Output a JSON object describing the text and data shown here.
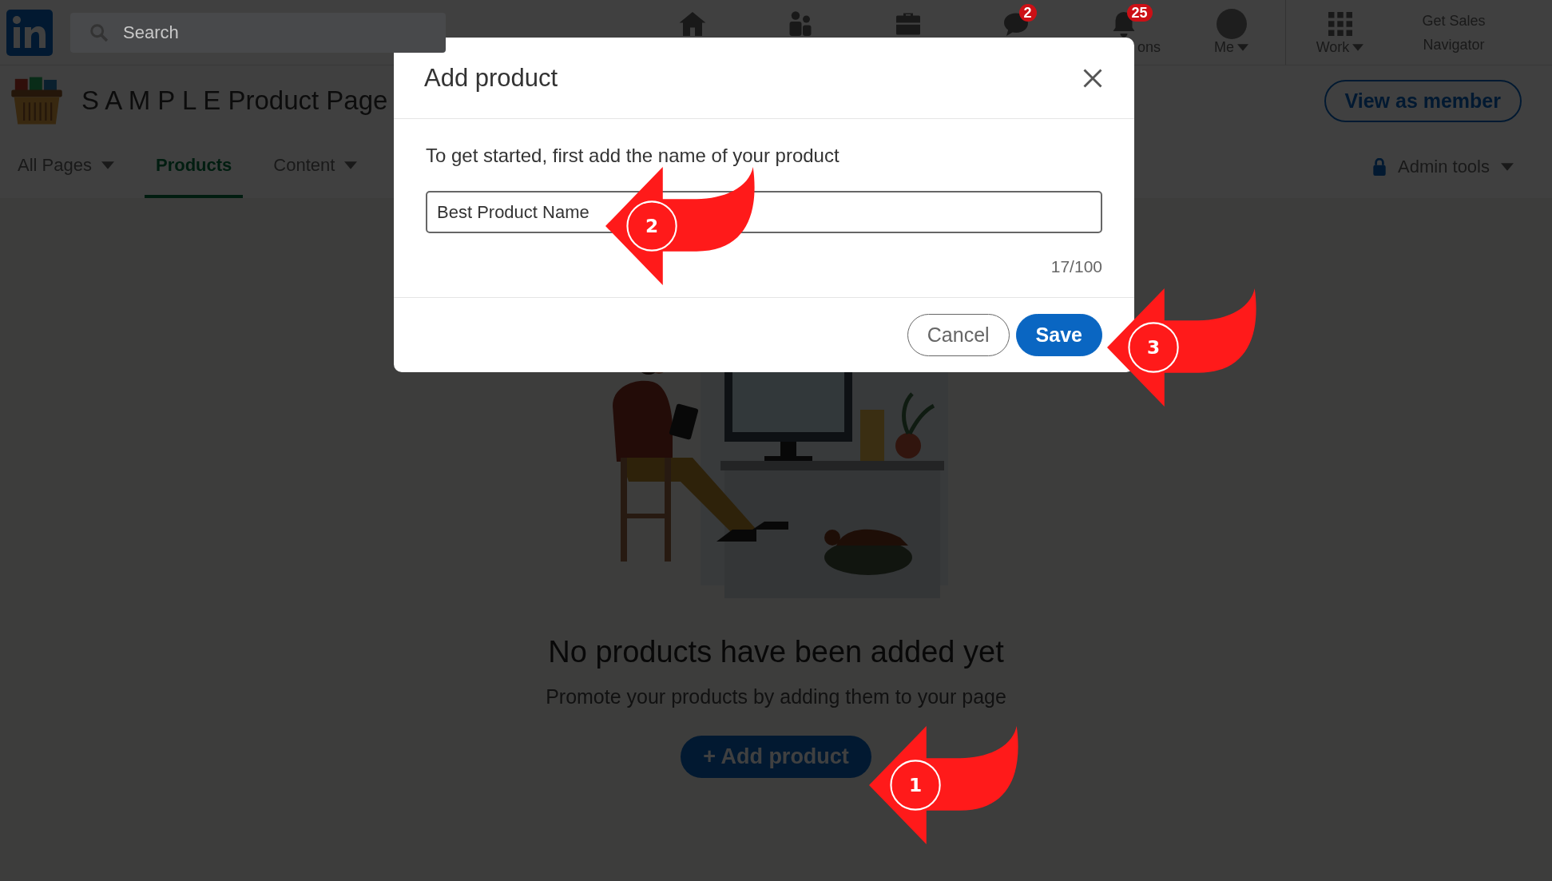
{
  "nav": {
    "search": {
      "placeholder": "Search"
    },
    "items": [
      {
        "kind": "home"
      },
      {
        "kind": "people"
      },
      {
        "kind": "briefcase"
      },
      {
        "kind": "chat",
        "badge": "2"
      },
      {
        "kind": "bell",
        "label": "ons",
        "badge": "25"
      },
      {
        "kind": "avatar",
        "label": "Me",
        "dropdown": true
      },
      {
        "kind": "grid",
        "label": "Work",
        "dropdown": true
      },
      {
        "kind": "text",
        "label": "Get Sales Navigator"
      }
    ]
  },
  "page_header": {
    "title": "S A M P L E Product Page",
    "button": "View as member"
  },
  "tabs": [
    {
      "label": "All Pages",
      "selected": false,
      "dropdown": true
    },
    {
      "label": "Products",
      "selected": true
    },
    {
      "label": "Content",
      "selected": false,
      "dropdown": true
    }
  ],
  "admin_tools": {
    "label": "Admin tools",
    "dropdown": true
  },
  "empty_state": {
    "title": "No products have been added yet",
    "subtitle": "Promote your products by adding them to your page",
    "button": "+ Add product"
  },
  "dialog": {
    "title": "Add product",
    "prompt": "To get started, first add the name of your product",
    "input": {
      "value": "Best Product Name"
    },
    "counter": "17/100",
    "buttons": [
      {
        "label": "Cancel",
        "kind": "secondary"
      },
      {
        "label": "Save",
        "kind": "primary"
      }
    ]
  },
  "callouts": [
    {
      "number": "2"
    },
    {
      "number": "3"
    },
    {
      "number": "1"
    }
  ]
}
